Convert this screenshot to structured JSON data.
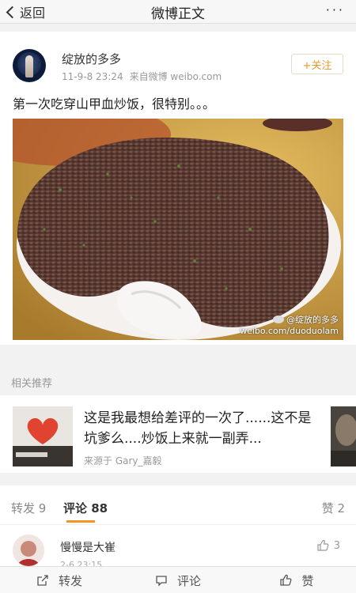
{
  "header": {
    "back_label": "返回",
    "title": "微博正文",
    "more_label": "···"
  },
  "post": {
    "username": "绽放的多多",
    "time": "11-9-8 23:24",
    "source": "来自微博 weibo.com",
    "follow_label": "+关注",
    "text": "第一次吃穿山甲血炒饭，很特别。。。",
    "watermark_name": "@绽放的多多",
    "watermark_url": "weibo.com/duoduolam"
  },
  "related": {
    "label": "相关推荐",
    "card": {
      "text": "这是我最想给差评的一次了......这不是坑爹么....炒饭上来就一副弄...",
      "source": "来源于 Gary_嘉毅"
    }
  },
  "tabs": {
    "repost": "转发 9",
    "comment": "评论 88",
    "like": "赞 2"
  },
  "comment": {
    "name": "慢慢是大崔",
    "time": "2-6 23:15",
    "likes": "3"
  },
  "bottombar": {
    "repost": "转发",
    "comment": "评论",
    "like": "赞"
  },
  "colors": {
    "accent": "#f59323",
    "follow": "#e79a2f"
  }
}
